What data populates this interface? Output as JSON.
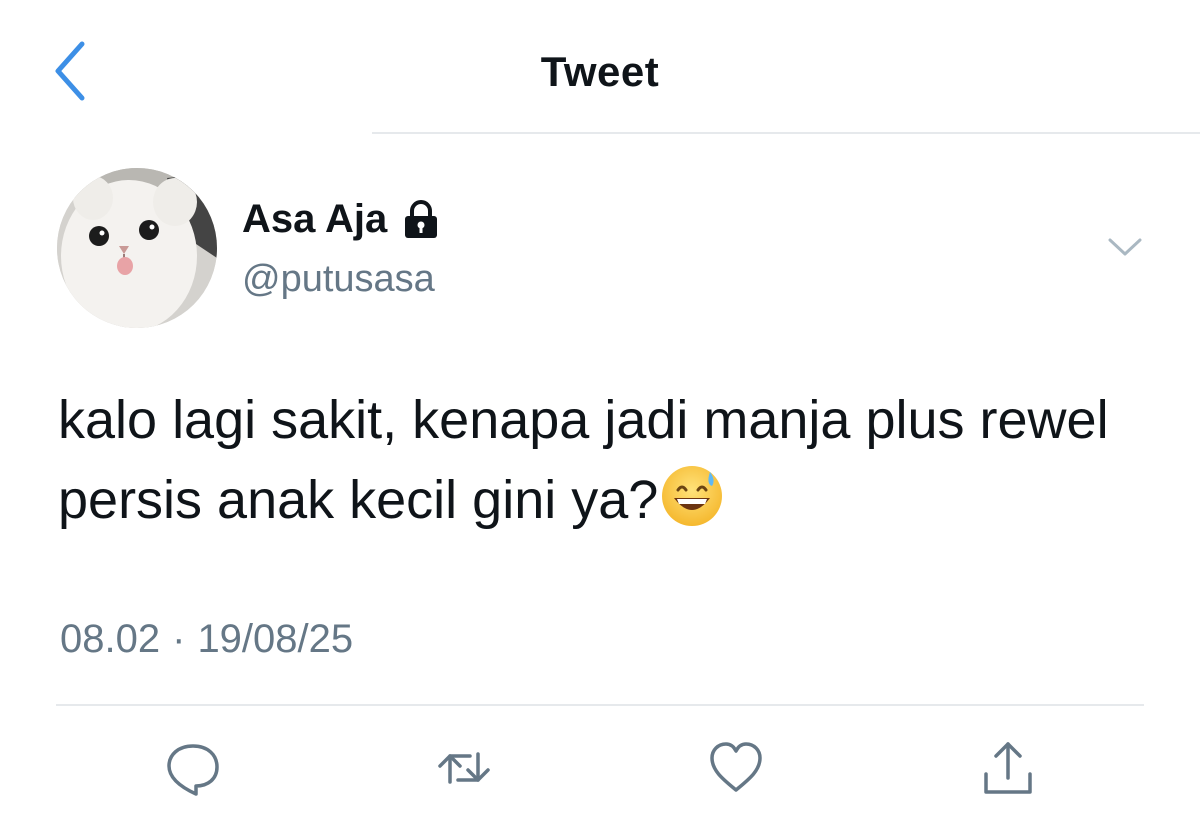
{
  "header": {
    "title": "Tweet",
    "back_icon": "chevron-left-icon"
  },
  "author": {
    "name": "Asa Aja",
    "handle": "@putusasa",
    "protected_icon": "lock-icon",
    "avatar": "white-cat-avatar"
  },
  "tweet": {
    "text": "kalo lagi sakit, kenapa jadi manja plus rewel persis anak kecil gini ya?",
    "emoji": "grinning-face-with-sweat-emoji"
  },
  "meta": {
    "time": "08.02",
    "separator": "·",
    "date": "19/08/25"
  },
  "actions": [
    {
      "name": "reply",
      "icon": "reply-icon"
    },
    {
      "name": "retweet",
      "icon": "retweet-icon"
    },
    {
      "name": "like",
      "icon": "heart-icon"
    },
    {
      "name": "share",
      "icon": "share-icon"
    }
  ],
  "colors": {
    "accent": "#1da1f2",
    "text_primary": "#0f1419",
    "text_secondary": "#657786",
    "divider": "#e6e9ec"
  }
}
